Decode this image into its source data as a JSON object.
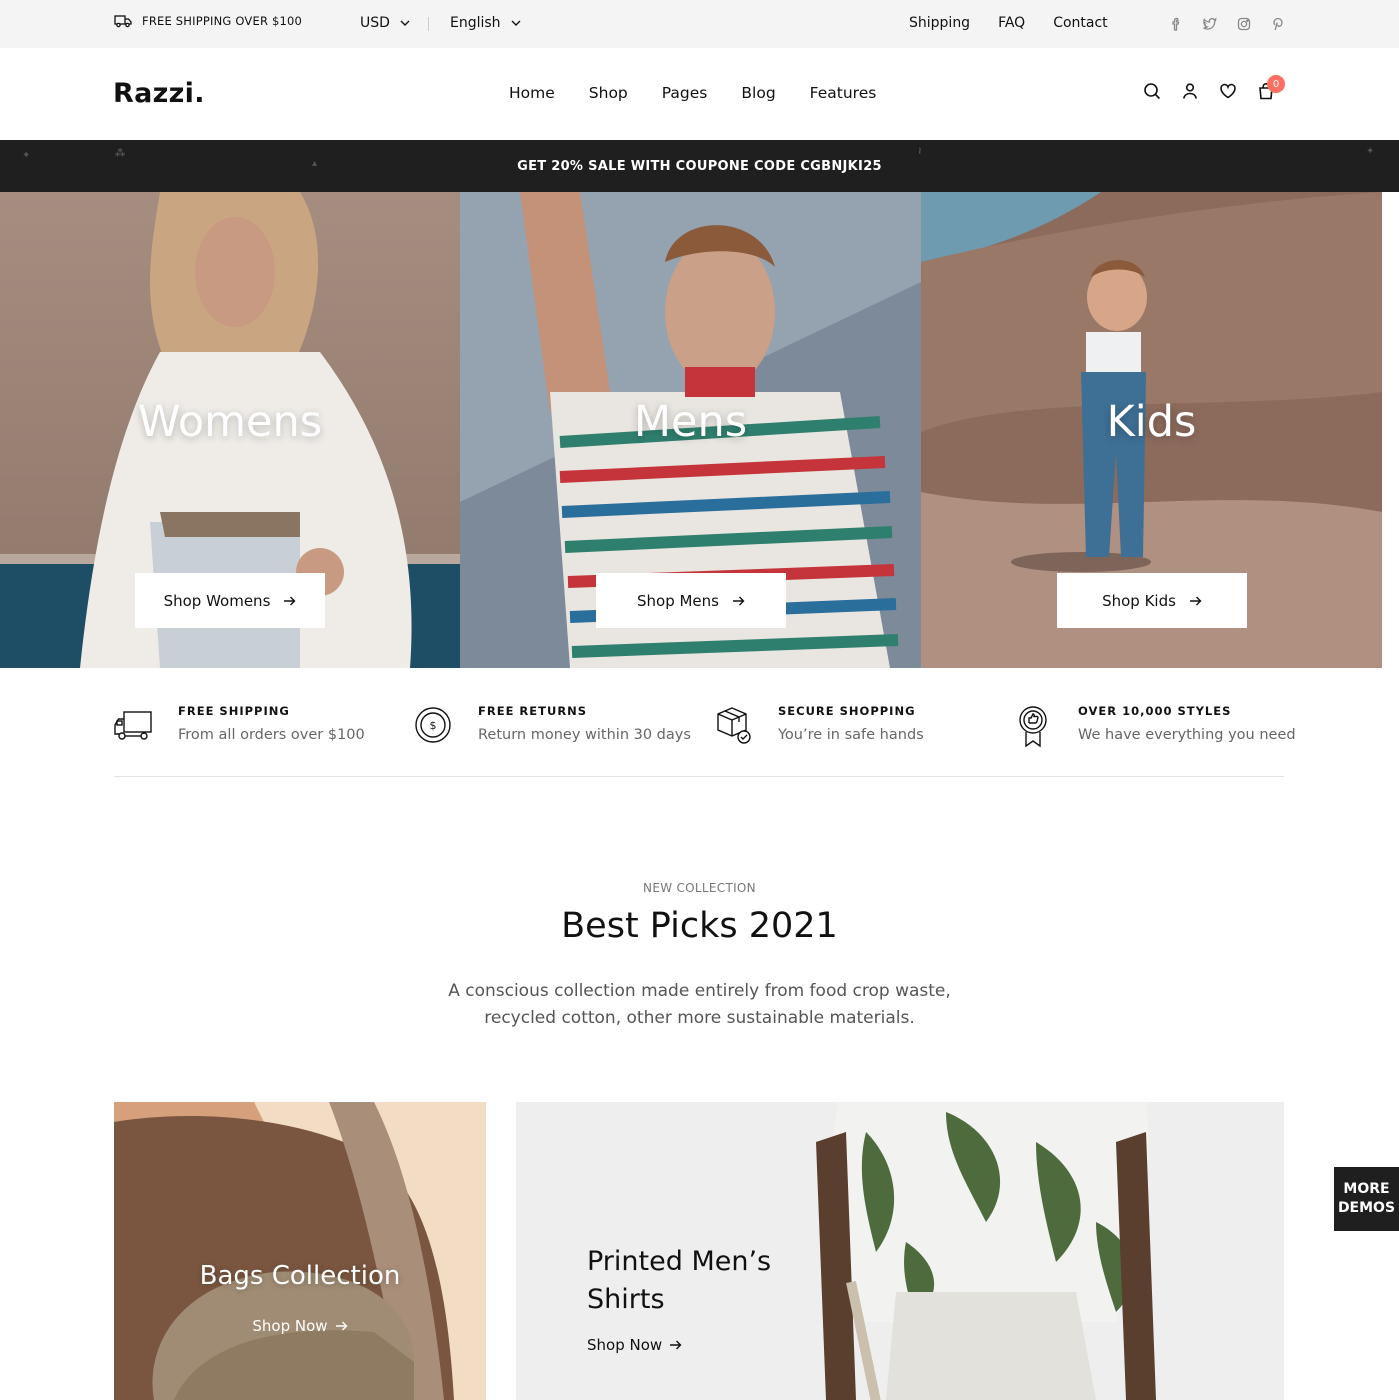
{
  "topbar": {
    "free_shipping": "FREE SHIPPING OVER $100",
    "currency": "USD",
    "language": "English",
    "links": [
      "Shipping",
      "FAQ",
      "Contact"
    ],
    "social_icons": [
      "facebook-icon",
      "twitter-icon",
      "instagram-icon",
      "pinterest-icon"
    ]
  },
  "header": {
    "logo": "Razzi.",
    "nav": [
      "Home",
      "Shop",
      "Pages",
      "Blog",
      "Features"
    ],
    "icons": [
      "search-icon",
      "user-icon",
      "heart-icon",
      "bag-icon"
    ],
    "cart_count": "0"
  },
  "promo": {
    "text": "GET 20% SALE WITH COUPONE CODE CGBNJKI25"
  },
  "hero": [
    {
      "title": "Womens",
      "button": "Shop Womens"
    },
    {
      "title": "Mens",
      "button": "Shop Mens"
    },
    {
      "title": "Kids",
      "button": "Shop Kids"
    }
  ],
  "features": [
    {
      "icon": "truck-icon",
      "title": "FREE SHIPPING",
      "subtitle": "From all orders over $100"
    },
    {
      "icon": "coin-icon",
      "title": "FREE RETURNS",
      "subtitle": "Return money within 30 days"
    },
    {
      "icon": "box-icon",
      "title": "SECURE SHOPPING",
      "subtitle": "You’re in safe hands"
    },
    {
      "icon": "badge-icon",
      "title": "OVER 10,000 STYLES",
      "subtitle": "We have everything you need"
    }
  ],
  "collection": {
    "kicker": "NEW COLLECTION",
    "title": "Best Picks 2021",
    "description": "A conscious collection made entirely from food crop waste, recycled cotton, other more sustainable materials."
  },
  "cards": {
    "bags": {
      "title": "Bags Collection",
      "link": "Shop Now"
    },
    "shirts": {
      "title_line1": "Printed Men’s",
      "title_line2": "Shirts",
      "link": "Shop Now"
    }
  },
  "more_demos": {
    "line1": "MORE",
    "line2": "DEMOS"
  },
  "colors": {
    "accent": "#ff6f61",
    "dark": "#1f1f1f",
    "topbar_bg": "#f4f4f4"
  }
}
